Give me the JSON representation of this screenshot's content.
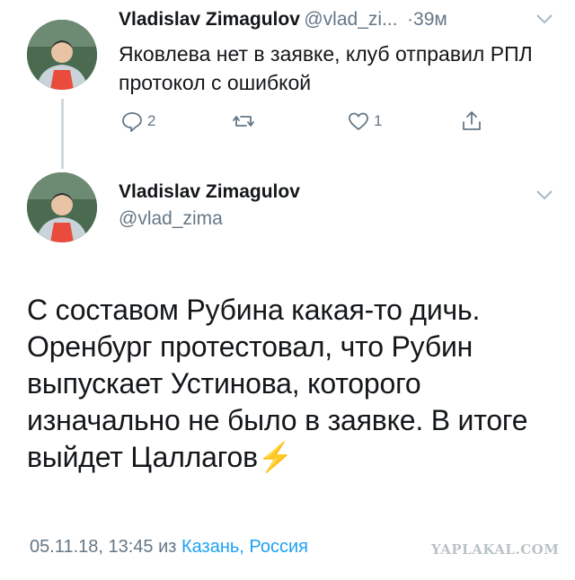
{
  "reply_tweet": {
    "author_name": "Vladislav Zimagulov",
    "author_handle": "@vlad_zi...",
    "time_separator": "·",
    "time": "39м",
    "text": "Яковлева нет в заявке, клуб отправил РПЛ протокол с ошибкой",
    "reply_count": "2",
    "retweet_count": "",
    "like_count": "1"
  },
  "main_tweet": {
    "author_name": "Vladislav Zimagulov",
    "author_handle": "@vlad_zima",
    "text": "С составом Рубина какая-то дичь. Оренбург протестовал, что Рубин выпускает Устинова, которого изначально не было в заявке. В итоге выйдет Цаллагов",
    "emoji": "⚡",
    "date": "05.11.18, 13:45",
    "location_prefix": "из",
    "location": "Казань, Россия"
  },
  "watermark": "YAPLAKAL.COM",
  "colors": {
    "link": "#1da1f2",
    "muted": "#657786",
    "thread_line": "#cfd8dc"
  },
  "icons": [
    "reply-icon",
    "retweet-icon",
    "like-icon",
    "share-icon",
    "chevron-down-icon",
    "lightning-emoji"
  ]
}
